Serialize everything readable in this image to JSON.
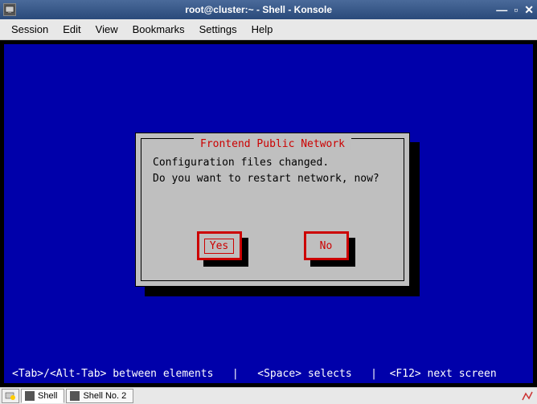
{
  "window": {
    "title": "root@cluster:~ - Shell - Konsole"
  },
  "menu": {
    "session": "Session",
    "edit": "Edit",
    "view": "View",
    "bookmarks": "Bookmarks",
    "settings": "Settings",
    "help": "Help"
  },
  "dialog": {
    "title": " Frontend Public Network ",
    "line1": "Configuration files changed.",
    "line2": "Do you want to restart network, now?",
    "yes": "Yes",
    "no": "No"
  },
  "hints": "<Tab>/<Alt-Tab> between elements   |   <Space> selects   |  <F12> next screen",
  "tabs": {
    "shell": "Shell",
    "shell2": "Shell No. 2"
  }
}
